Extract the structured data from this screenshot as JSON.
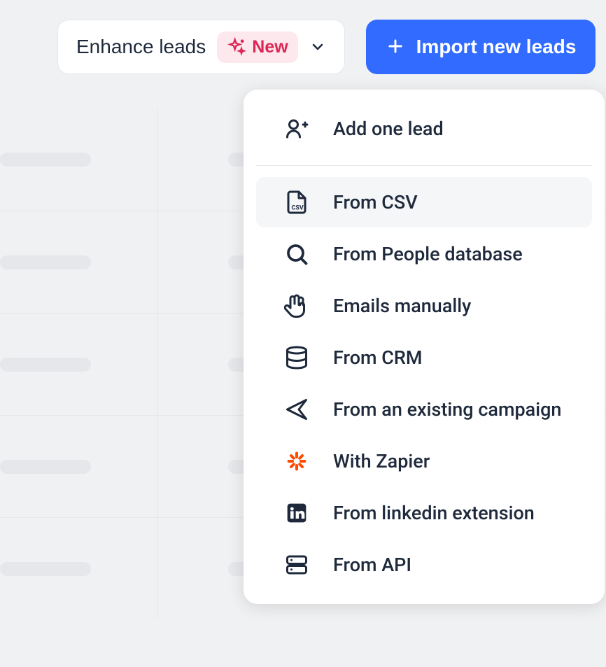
{
  "toolbar": {
    "enhance": {
      "label": "Enhance leads",
      "badge": "New"
    },
    "import": {
      "label": "Import new leads"
    }
  },
  "dropdown": {
    "primary": {
      "label": "Add one lead"
    },
    "items": [
      {
        "label": "From CSV",
        "icon": "file-csv",
        "hover": true
      },
      {
        "label": "From People database",
        "icon": "search"
      },
      {
        "label": "Emails manually",
        "icon": "hand"
      },
      {
        "label": "From CRM",
        "icon": "database"
      },
      {
        "label": "From an existing campaign",
        "icon": "send"
      },
      {
        "label": "With Zapier",
        "icon": "zapier"
      },
      {
        "label": "From linkedin extension",
        "icon": "linkedin"
      },
      {
        "label": "From API",
        "icon": "server"
      }
    ]
  }
}
